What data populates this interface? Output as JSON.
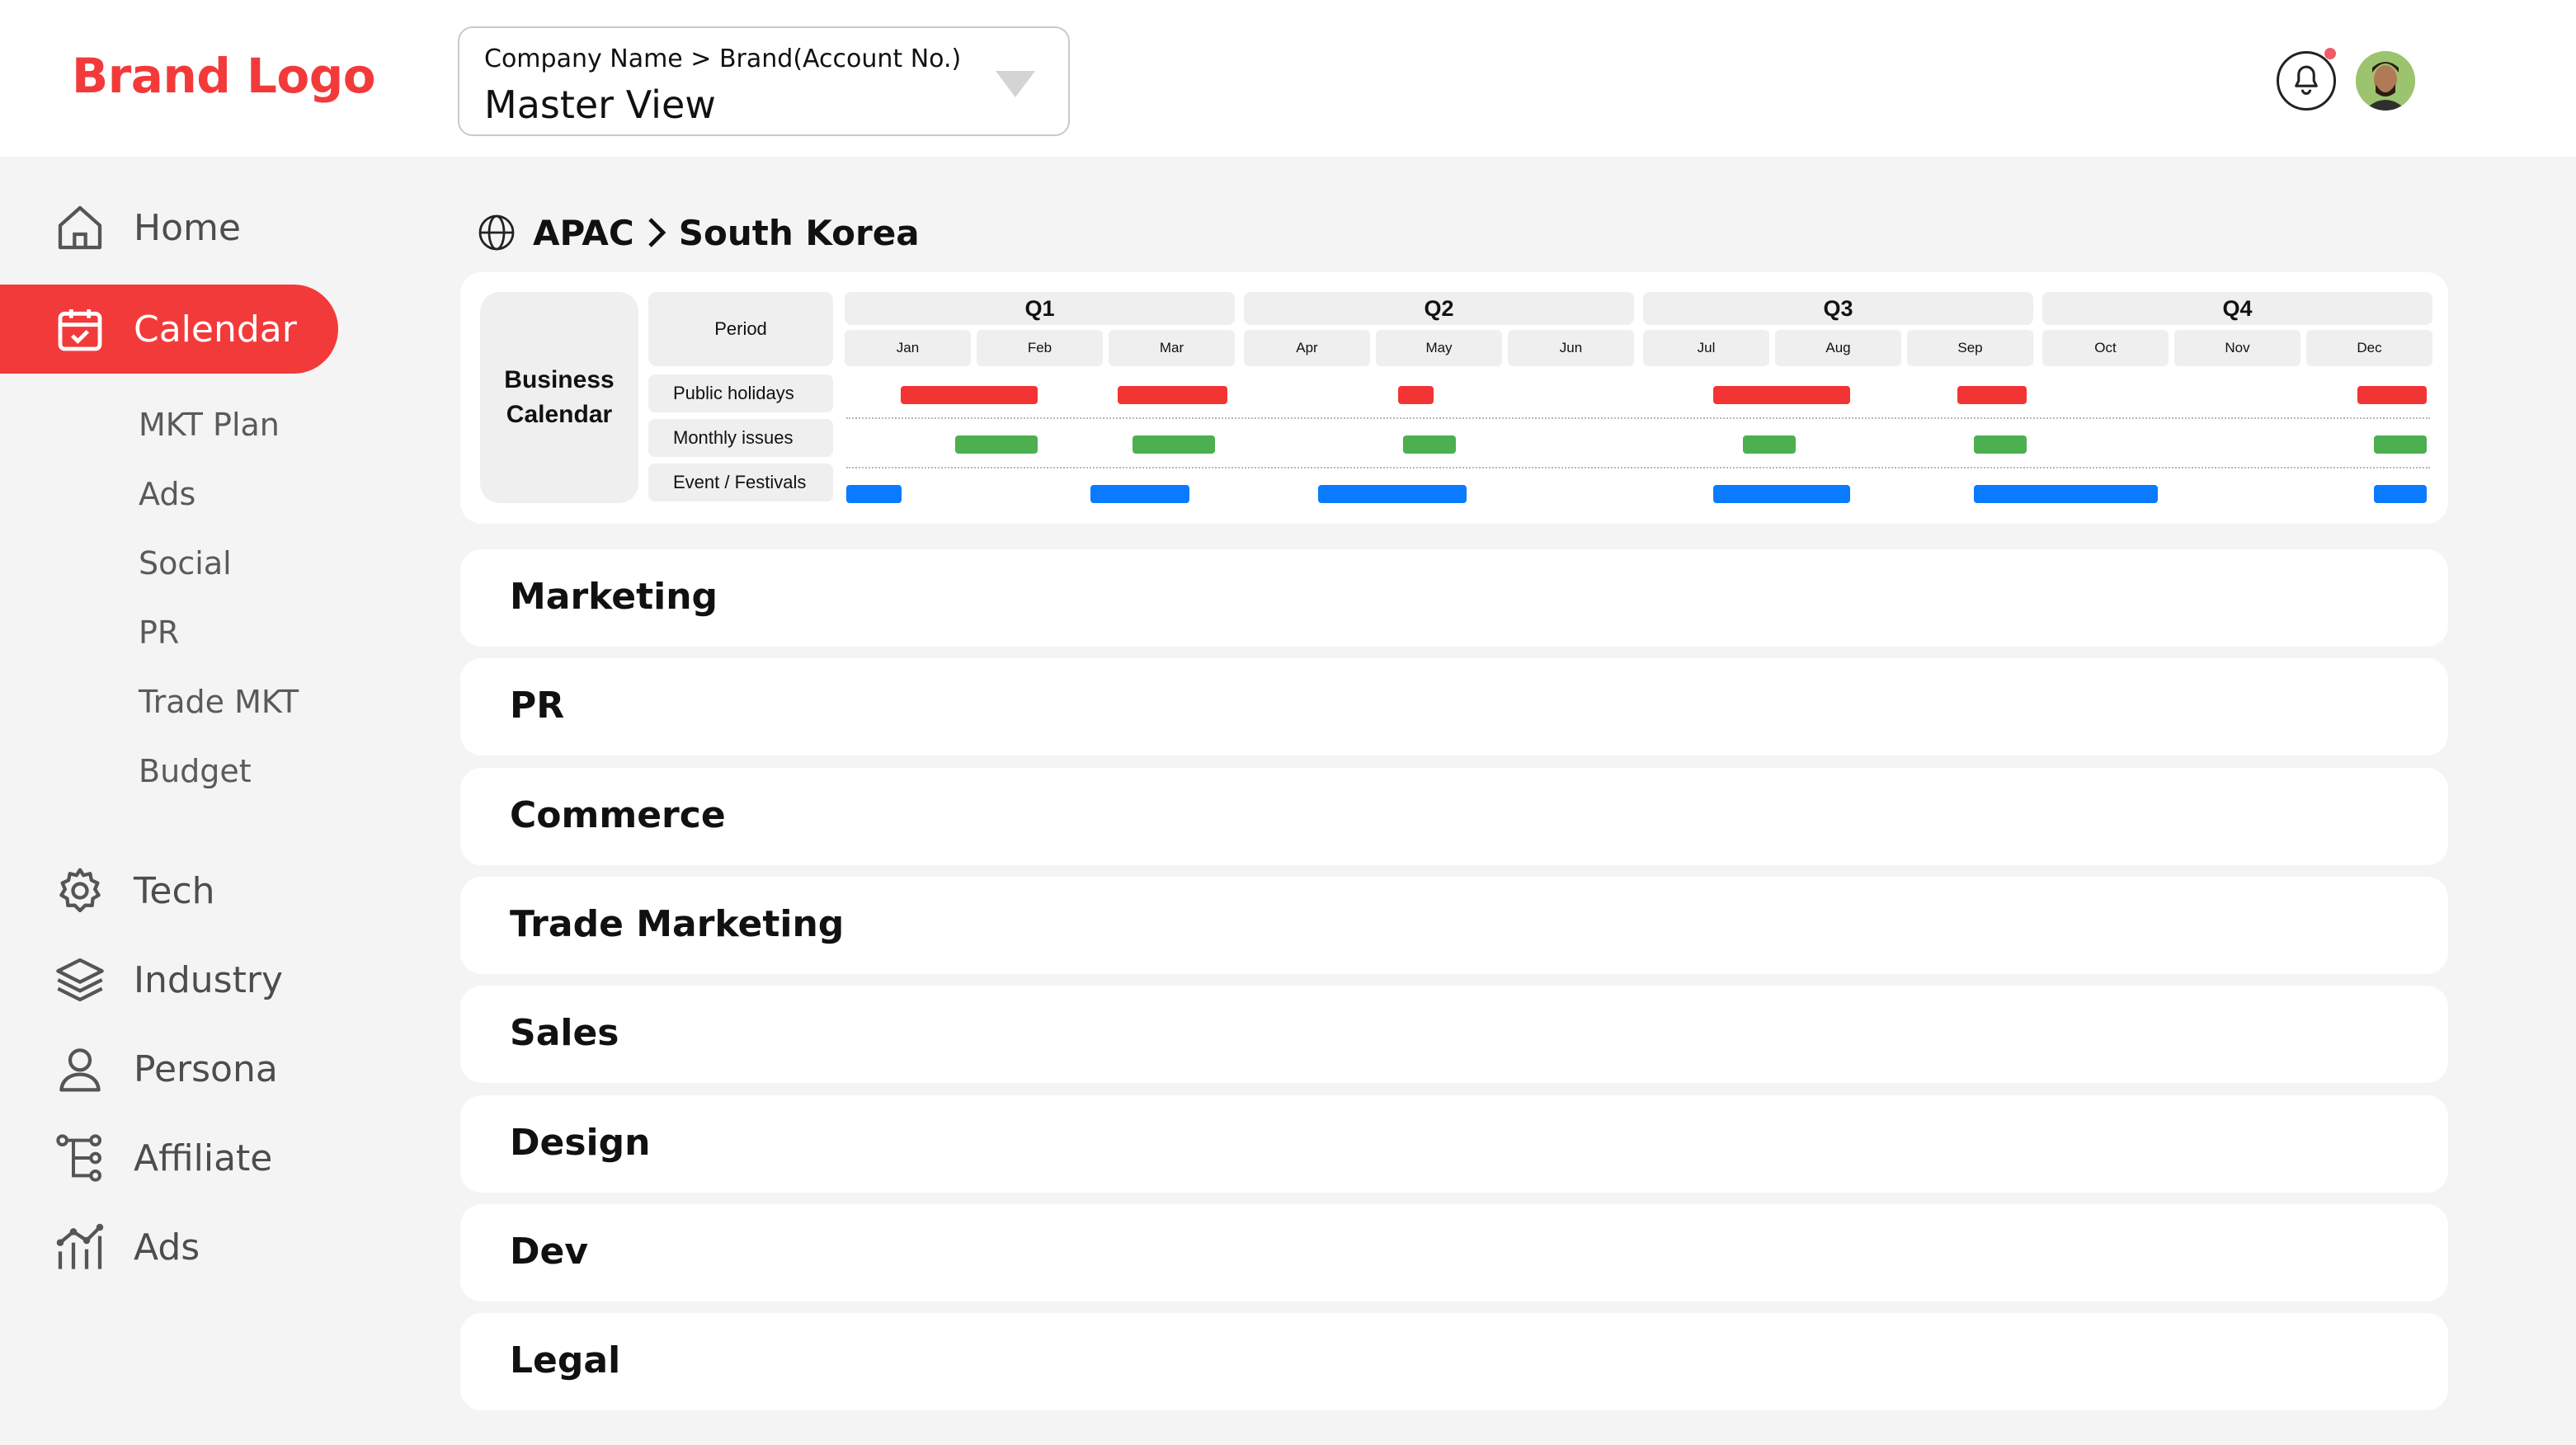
{
  "header": {
    "brand": "Brand Logo",
    "account_path": "Company Name > Brand(Account No.)",
    "account_view": "Master View"
  },
  "sidebar": {
    "items": [
      {
        "label": "Home",
        "icon": "home-icon"
      },
      {
        "label": "Calendar",
        "icon": "calendar-icon",
        "active": true
      },
      {
        "label": "Tech",
        "icon": "gear-icon"
      },
      {
        "label": "Industry",
        "icon": "layers-icon"
      },
      {
        "label": "Persona",
        "icon": "user-icon"
      },
      {
        "label": "Affiliate",
        "icon": "tree-icon"
      },
      {
        "label": "Ads",
        "icon": "chart-icon"
      }
    ],
    "calendar_sub": [
      "MKT Plan",
      "Ads",
      "Social",
      "PR",
      "Trade MKT",
      "Budget"
    ]
  },
  "breadcrumb": {
    "region": "APAC",
    "country": "South Korea"
  },
  "calendar": {
    "title_line1": "Business",
    "title_line2": "Calendar",
    "period_label": "Period",
    "rows": [
      "Public holidays",
      "Monthly issues",
      "Event / Festivals"
    ],
    "quarters": [
      "Q1",
      "Q2",
      "Q3",
      "Q4"
    ],
    "months": [
      "Jan",
      "Feb",
      "Mar",
      "Apr",
      "May",
      "Jun",
      "Jul",
      "Aug",
      "Sep",
      "Oct",
      "Nov",
      "Dec"
    ],
    "colors": {
      "holiday": "#f33434",
      "issue": "#4caf50",
      "event": "#0a7bff"
    }
  },
  "sections": [
    "Marketing",
    "PR",
    "Commerce",
    "Trade Marketing",
    "Sales",
    "Design",
    "Dev",
    "Legal"
  ],
  "theme": {
    "accent": "#f33a3a",
    "background": "#f4f4f4"
  }
}
